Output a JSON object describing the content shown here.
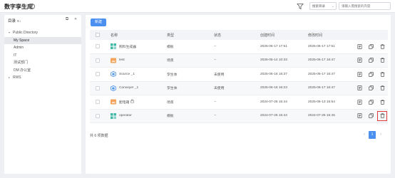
{
  "header": {
    "title": "数字孪生库",
    "search_scope": "搜索目录",
    "search_placeholder": "请输入需搜索的内容"
  },
  "sidebar": {
    "heading": "目录",
    "tree": [
      {
        "label": "Public Directory",
        "level": 0,
        "expanded": true,
        "selected": false
      },
      {
        "label": "My Space",
        "level": 1,
        "expanded": false,
        "selected": true
      },
      {
        "label": "Admin",
        "level": 1,
        "expanded": false,
        "selected": false
      },
      {
        "label": "IT",
        "level": 1,
        "expanded": false,
        "selected": false
      },
      {
        "label": "测试部门",
        "level": 1,
        "expanded": false,
        "selected": false
      },
      {
        "label": "DM 办公室",
        "level": 1,
        "expanded": false,
        "selected": false
      },
      {
        "label": "RWS",
        "level": 0,
        "expanded": false,
        "selected": false
      }
    ]
  },
  "main": {
    "new_button": "新建",
    "columns": {
      "name": "名称",
      "type": "类型",
      "status": "状态",
      "created": "创建时间",
      "modified": "修改时间"
    },
    "rows": [
      {
        "name": "照料生成器",
        "type": "模板",
        "status": "--",
        "created": "2025-06-17 17:51",
        "modified": "2025-06-17 17:51",
        "icon": "template-icon",
        "locked": false
      },
      {
        "name": "test",
        "type": "场景",
        "status": "--",
        "created": "2025-05-14 10:33",
        "modified": "2025-06-17 16:47",
        "icon": "scene-icon",
        "locked": false
      },
      {
        "name": "Source _1",
        "type": "孪生体",
        "status": "未使用",
        "created": "2025-06-16 16:37",
        "modified": "2025-06-17 16:47",
        "icon": "twin-icon",
        "locked": false
      },
      {
        "name": "Conveyer _1",
        "type": "孪生体",
        "status": "未使用",
        "created": "2025-06-16 16:23",
        "modified": "2025-06-17 16:47",
        "icon": "twin-icon",
        "locked": false
      },
      {
        "name": "配电箱",
        "type": "场景",
        "status": "--",
        "created": "2024-07-25 15:44",
        "modified": "2025-06-13 15:54",
        "icon": "scene-icon",
        "locked": true
      },
      {
        "name": "operator",
        "type": "模板",
        "status": "--",
        "created": "2024-07-25 15:44",
        "modified": "2024-07-25 16:45",
        "icon": "template-icon",
        "locked": false
      }
    ],
    "total_text": "共 6 项数据",
    "page": "1"
  },
  "colors": {
    "accent": "#4b8ff0",
    "template": "#3fb8a6",
    "scene": "#f4a35a",
    "twin": "#5b9be8",
    "highlight": "#e03a3a"
  }
}
